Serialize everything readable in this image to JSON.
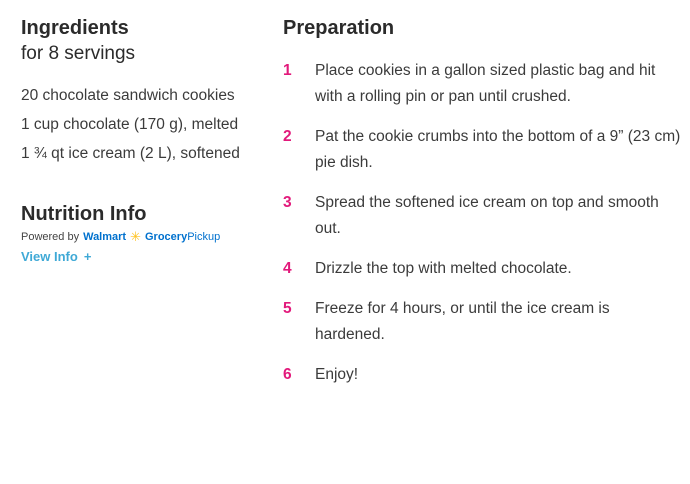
{
  "ingredients": {
    "title": "Ingredients",
    "servings": "for 8 servings",
    "items": [
      "20 chocolate sandwich cookies",
      "1 cup chocolate (170 g), melted",
      "1 ¾ qt ice cream (2 L), softened"
    ]
  },
  "nutrition": {
    "title": "Nutrition Info",
    "powered_by": "Powered by",
    "brand_walmart": "Walmart",
    "brand_grocery": "Grocery",
    "brand_pickup": "Pickup",
    "view_info": "View Info",
    "view_info_icon": "+"
  },
  "preparation": {
    "title": "Preparation",
    "steps": [
      {
        "num": "1",
        "text": "Place cookies in a gallon sized plastic bag and hit with a rolling pin or pan until crushed."
      },
      {
        "num": "2",
        "text": "Pat the cookie crumbs into the bottom of a 9” (23 cm) pie dish."
      },
      {
        "num": "3",
        "text": "Spread the softened ice cream on top and smooth out."
      },
      {
        "num": "4",
        "text": "Drizzle the top with melted chocolate."
      },
      {
        "num": "5",
        "text": "Freeze for 4 hours, or until the ice cream is hardened."
      },
      {
        "num": "6",
        "text": "Enjoy!"
      }
    ]
  },
  "colors": {
    "step_number": "#e2197b",
    "link": "#3fa9d6",
    "walmart_blue": "#0071ce",
    "walmart_spark": "#ffc220"
  }
}
